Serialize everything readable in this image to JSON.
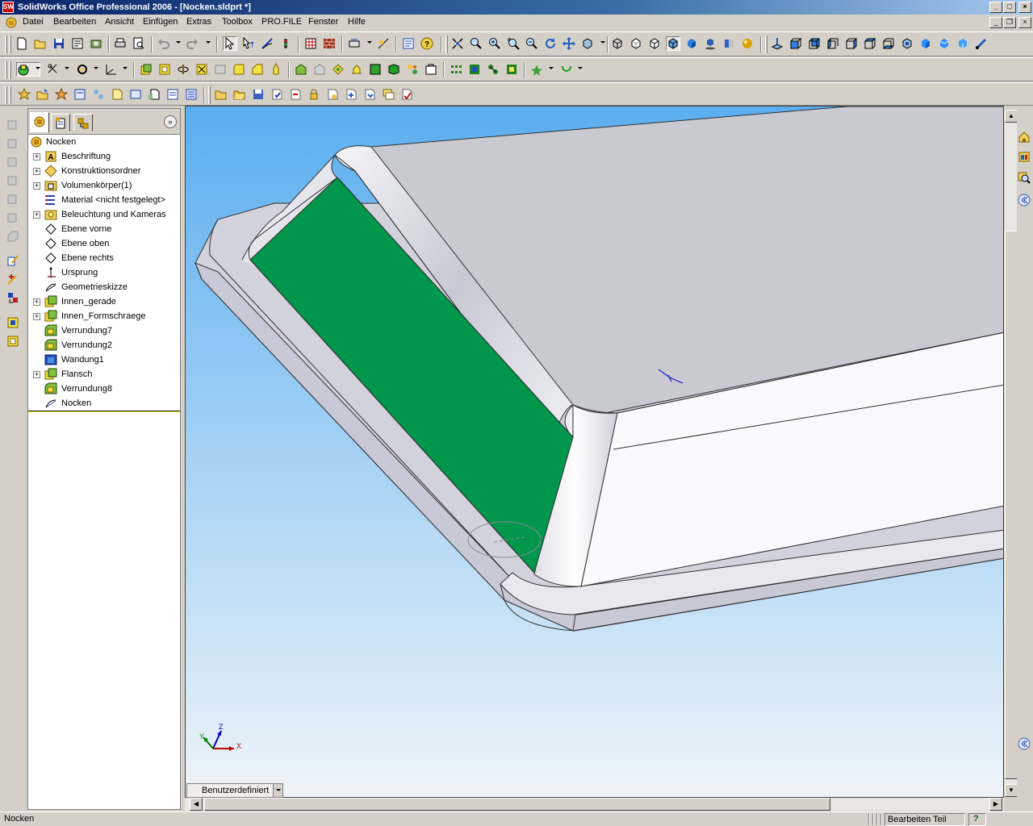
{
  "window": {
    "title": "SolidWorks Office Professional 2006 - [Nocken.sldprt *]",
    "app_icon_text": "SW",
    "controls": [
      "minimize",
      "maximize",
      "close"
    ]
  },
  "menubar": {
    "items": [
      "Datei",
      "Bearbeiten",
      "Ansicht",
      "Einfügen",
      "Extras",
      "Toolbox",
      "PRO.FILE",
      "Fenster",
      "Hilfe"
    ]
  },
  "toolbars": {
    "standard": [
      "new-icon",
      "open-icon",
      "save-icon",
      "print-preview-icon",
      "options-icon",
      "print-icon",
      "preview-icon",
      "undo-icon",
      "redo-icon",
      "select-icon",
      "select-filter-icon",
      "sketch-icon",
      "rebuild-icon",
      "grid-icon",
      "brick-icon",
      "dimension-icon",
      "measure-icon",
      "properties-icon",
      "help-icon",
      "zoom-fit-icon",
      "zoom-area-icon",
      "zoom-in-icon",
      "zoom-selection-icon",
      "zoom-out-icon",
      "rotate-icon",
      "pan-icon",
      "view-orientation-icon",
      "wireframe-icon",
      "hidden-lines-visible-icon",
      "hidden-lines-removed-icon",
      "shaded-edges-icon",
      "shaded-icon",
      "shadows-icon",
      "section-view-icon",
      "realview-icon",
      "normal-to-icon",
      "front-view-icon",
      "back-view-icon",
      "left-view-icon",
      "right-view-icon",
      "top-view-icon",
      "bottom-view-icon",
      "isometric-icon",
      "trimetric-icon",
      "dimetric-icon",
      "link-views-icon"
    ],
    "features": [
      "feature-extrude-icon",
      "reference-geometry-icon",
      "curves-icon",
      "boss-extrude-icon",
      "cut-extrude-icon",
      "revolve-icon",
      "sweep-icon",
      "loft-icon",
      "fillet-icon",
      "chamfer-icon",
      "shell-icon",
      "rib-icon",
      "draft-icon",
      "dome-icon",
      "mirror-icon",
      "pattern-icon",
      "linear-pattern-icon",
      "circular-pattern-icon",
      "feature-palette-icon",
      "flex-icon",
      "instant3d-icon",
      "deform-icon"
    ],
    "data": [
      "profile-new-icon",
      "profile-open-icon",
      "profile-save-icon",
      "profile-info-icon",
      "profile-list-icon",
      "profile-check-icon",
      "profile-attr-icon",
      "profile-doc-icon",
      "profile-link-icon",
      "profile-version-icon",
      "folder-open-icon",
      "folder-icon",
      "save-db-icon",
      "check-in-icon",
      "check-out-icon",
      "lock-icon",
      "refresh-icon",
      "document-icon",
      "attach-icon",
      "notes-icon",
      "report-icon"
    ]
  },
  "feature_tree": {
    "tabs": [
      "featuremanager-tab",
      "propertymanager-tab",
      "configurationmanager-tab"
    ],
    "expand_label": "»",
    "nodes": [
      {
        "label": "Nocken",
        "icon": "part-icon",
        "expandable": false,
        "root": true
      },
      {
        "label": "Beschriftung",
        "icon": "annotations-icon",
        "expandable": true
      },
      {
        "label": "Konstruktionsordner",
        "icon": "design-binder-icon",
        "expandable": true
      },
      {
        "label": "Volumenkörper(1)",
        "icon": "solid-bodies-icon",
        "expandable": true
      },
      {
        "label": "Material <nicht festgelegt>",
        "icon": "material-icon",
        "expandable": false
      },
      {
        "label": "Beleuchtung und Kameras",
        "icon": "lights-cameras-icon",
        "expandable": true
      },
      {
        "label": "Ebene vorne",
        "icon": "plane-icon",
        "expandable": false
      },
      {
        "label": "Ebene oben",
        "icon": "plane-icon",
        "expandable": false
      },
      {
        "label": "Ebene rechts",
        "icon": "plane-icon",
        "expandable": false
      },
      {
        "label": "Ursprung",
        "icon": "origin-icon",
        "expandable": false
      },
      {
        "label": "Geometrieskizze",
        "icon": "sketch-icon",
        "expandable": false
      },
      {
        "label": "Innen_gerade",
        "icon": "extrude-feature-icon",
        "expandable": true
      },
      {
        "label": "Innen_Formschraege",
        "icon": "extrude-feature-icon",
        "expandable": true
      },
      {
        "label": "Verrundung7",
        "icon": "fillet-feature-icon",
        "expandable": false
      },
      {
        "label": "Verrundung2",
        "icon": "fillet-feature-icon",
        "expandable": false
      },
      {
        "label": "Wandung1",
        "icon": "shell-feature-icon",
        "expandable": false
      },
      {
        "label": "Flansch",
        "icon": "extrude-feature-icon",
        "expandable": true
      },
      {
        "label": "Verrundung8",
        "icon": "fillet-feature-icon",
        "expandable": false
      },
      {
        "label": "Nocken",
        "icon": "sketch-icon",
        "expandable": false
      }
    ]
  },
  "viewport": {
    "background_top": "#5aaef0",
    "background_bottom": "#eef4f8",
    "selected_face_color": "#00964b",
    "triad_axes": [
      "X",
      "Y",
      "Z"
    ]
  },
  "config_tab": {
    "label": "Benutzerdefiniert"
  },
  "statusbar": {
    "left_text": "Nocken",
    "right_text": "Bearbeiten Teil",
    "help_icon": "?"
  }
}
